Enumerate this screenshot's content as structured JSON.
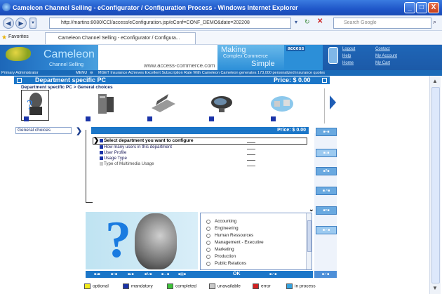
{
  "window": {
    "title": "Cameleon Channel Selling - eConfigurator / Configuration Process - Windows Internet Explorer",
    "minimize": "_",
    "maximize": "□",
    "close": "X"
  },
  "browser": {
    "address": "http://martins:8080/CCl/access/eConfiguration.jsp/eConf=CONF_DEMO&date=202208",
    "search_placeholder": "Search Google",
    "favorites_label": "Favorites",
    "tab_title": "Cameleon Channel Selling - eConfigurator / Configura..."
  },
  "header": {
    "logo_text": "Cameleon",
    "logo_sub": "Channel Selling",
    "domain": "www.access-commerce.com",
    "slogan_1": "Making",
    "slogan_2": "Complex Commerce",
    "slogan_3": "Simple",
    "access_logo": "access",
    "links": {
      "logout": "Logout",
      "contact": "Contact",
      "help": "Help",
      "my_account": "My Account",
      "home": "Home",
      "my_cart": "My Cart"
    }
  },
  "strip": {
    "role": "Primary Administrator",
    "menu": "MENU",
    "news": "MGET Insurance Achieves Excellent Subscription Rate With Cameleon Cameleon generates 173,000 personalized insurance quotes"
  },
  "page": {
    "title": "Department specific PC",
    "price": "Price: $ 0.00",
    "breadcrumb": "Department specific PC > General choices"
  },
  "section": {
    "general_choices": "General choices",
    "price": "Price: $ 0.00"
  },
  "config_items": [
    {
      "label": "Select department you want to configure",
      "status": "mandatory"
    },
    {
      "label": "How many users in this department",
      "status": "mandatory"
    },
    {
      "label": "User Profile",
      "status": "mandatory"
    },
    {
      "label": "Usage Type",
      "status": "mandatory"
    },
    {
      "label": "Type of Multimedia Usage",
      "status": "unavailable"
    }
  ],
  "departments": [
    "Accounting",
    "Engineering",
    "Human Ressources",
    "Management - Executive",
    "Marketing",
    "Production",
    "Public Relations"
  ],
  "toolbar": {
    "ok": "OK"
  },
  "legend": [
    {
      "label": "optional",
      "color": "#f2ea1c"
    },
    {
      "label": "mandatory",
      "color": "#1a33a8"
    },
    {
      "label": "completed",
      "color": "#3ec43a"
    },
    {
      "label": "unavailable",
      "color": "#c8c8c8"
    },
    {
      "label": "error",
      "color": "#d22020"
    },
    {
      "label": "in process",
      "color": "#35a3e0"
    }
  ]
}
